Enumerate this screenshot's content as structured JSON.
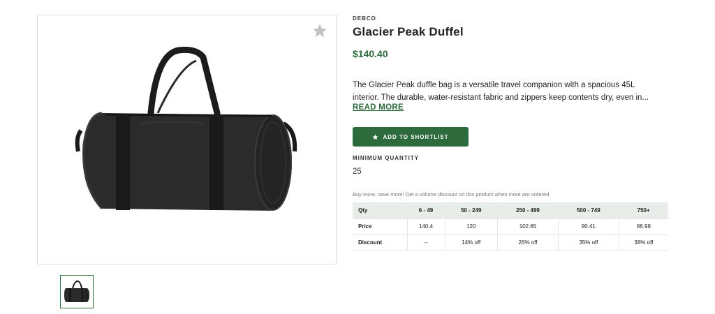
{
  "product": {
    "brand": "DEBCO",
    "title": "Glacier Peak Duffel",
    "price": "$140.40",
    "description_lines": [
      "The Glacier Peak duffle bag is a versatile travel companion with a spacious 45L",
      "interior. The durable, water-resistant fabric and zippers keep contents dry, even in..."
    ],
    "read_more": "READ MORE",
    "shortlist_button": "ADD TO SHORTLIST",
    "min_quantity_label": "MINIMUM QUANTITY",
    "min_quantity_value": "25",
    "discount_note": "Buy more, save more! Get a volume discount on this product when more are ordered."
  },
  "pricing_table": {
    "rows": [
      {
        "label": "Qty",
        "cells": [
          "6 - 49",
          "50 - 249",
          "250 - 499",
          "500 - 749",
          "750+"
        ]
      },
      {
        "label": "Price",
        "cells": [
          "140.4",
          "120",
          "102.65",
          "90.41",
          "86.98"
        ]
      },
      {
        "label": "Discount",
        "cells": [
          "--",
          "14% off",
          "26% off",
          "35% off",
          "38% off"
        ]
      }
    ]
  },
  "icons": {
    "favorite": "star-icon",
    "shortlist": "star-icon"
  },
  "colors": {
    "accent": "#2e6b3c",
    "table_header_bg": "#e8ede9",
    "star_inactive": "#c4c4c4"
  }
}
